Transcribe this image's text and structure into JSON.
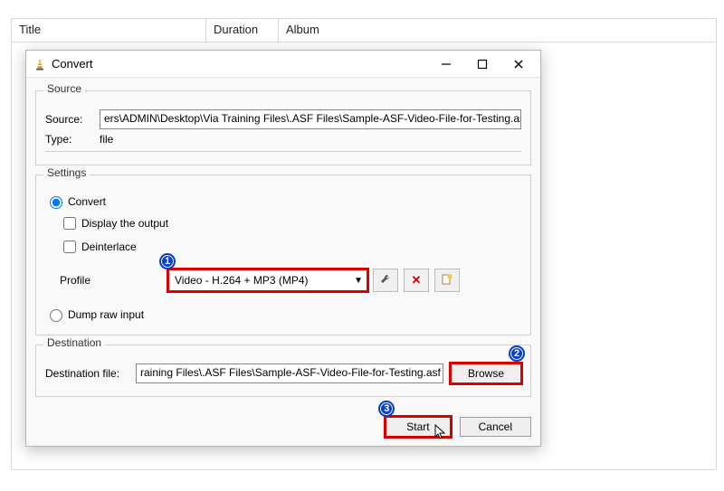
{
  "bg": {
    "col_title": "Title",
    "col_duration": "Duration",
    "col_album": "Album"
  },
  "dialog": {
    "title": "Convert",
    "source": {
      "group_label": "Source",
      "source_label": "Source:",
      "source_value": "ers\\ADMIN\\Desktop\\Via Training Files\\.ASF Files\\Sample-ASF-Video-File-for-Testing.asf",
      "type_label": "Type:",
      "type_value": "file"
    },
    "settings": {
      "group_label": "Settings",
      "convert_label": "Convert",
      "display_label": "Display the output",
      "deinterlace_label": "Deinterlace",
      "profile_label": "Profile",
      "profile_value": "Video - H.264 + MP3 (MP4)",
      "dump_label": "Dump raw input"
    },
    "destination": {
      "group_label": "Destination",
      "dest_label": "Destination file:",
      "dest_value": "raining Files\\.ASF Files\\Sample-ASF-Video-File-for-Testing.asf",
      "browse_label": "Browse"
    },
    "buttons": {
      "start": "Start",
      "cancel": "Cancel"
    }
  },
  "badges": {
    "one": "1",
    "two": "2",
    "three": "3"
  }
}
